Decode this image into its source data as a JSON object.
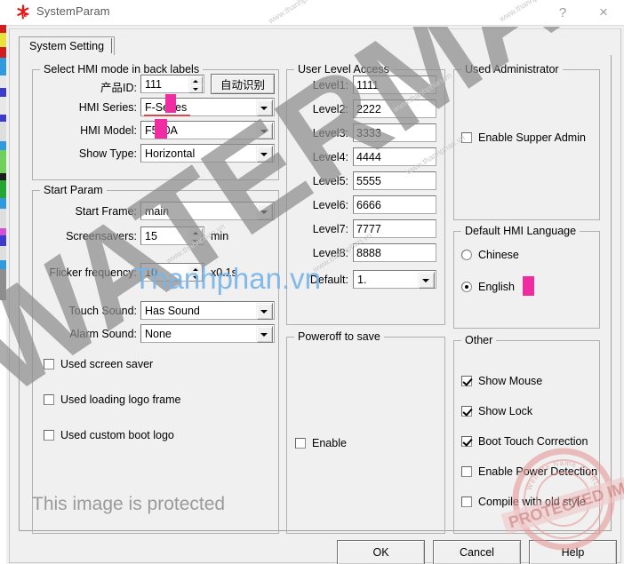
{
  "window": {
    "title": "SystemParam",
    "logo_icon": "red-cross-logo-icon",
    "help_label": "?",
    "close_label": "×"
  },
  "tabs": [
    {
      "label": "System Setting",
      "selected": true
    }
  ],
  "groups": {
    "hmi_mode": {
      "title": "Select HMI mode in back labels",
      "fields": {
        "product_id": {
          "label": "产品ID:",
          "value": "111"
        },
        "auto_detect_button": {
          "label": "自动识别"
        },
        "hmi_series": {
          "label": "HMI Series:",
          "value": "F-Series"
        },
        "hmi_model": {
          "label": "HMI Model:",
          "value": "F500A"
        },
        "show_type": {
          "label": "Show Type:",
          "value": "Horizontal"
        }
      }
    },
    "start_param": {
      "title": "Start Param",
      "fields": {
        "start_frame": {
          "label": "Start Frame:",
          "value": "main"
        },
        "screensavers": {
          "label": "Screensavers:",
          "value": "15",
          "unit": "min"
        },
        "flicker_frequency": {
          "label": "Flicker frequency:",
          "value": "10",
          "unit": "x0.1s"
        },
        "touch_sound": {
          "label": "Touch Sound:",
          "value": "Has Sound"
        },
        "alarm_sound": {
          "label": "Alarm Sound:",
          "value": "None"
        }
      },
      "checkboxes": [
        {
          "label": "Used screen saver",
          "checked": false
        },
        {
          "label": "Used loading logo frame",
          "checked": false
        },
        {
          "label": "Used custom boot logo",
          "checked": false
        }
      ]
    },
    "user_level_access": {
      "title": "User Level Access",
      "levels": [
        {
          "label": "Level1:",
          "value": "1111"
        },
        {
          "label": "Level2:",
          "value": "2222"
        },
        {
          "label": "Level3:",
          "value": "3333"
        },
        {
          "label": "Level4:",
          "value": "4444"
        },
        {
          "label": "Level5:",
          "value": "5555"
        },
        {
          "label": "Level6:",
          "value": "6666"
        },
        {
          "label": "Level7:",
          "value": "7777"
        },
        {
          "label": "Level8:",
          "value": "8888"
        }
      ],
      "default": {
        "label": "Default:",
        "value": "1."
      }
    },
    "poweroff_to_save": {
      "title": "Poweroff to save",
      "checkboxes": [
        {
          "label": "Enable",
          "checked": false
        }
      ]
    },
    "used_administrator": {
      "title": "Used Administrator",
      "checkboxes": [
        {
          "label": "Enable Supper Admin",
          "checked": false
        }
      ]
    },
    "default_hmi_language": {
      "title": "Default HMI Language",
      "options": [
        {
          "label": "Chinese",
          "selected": false
        },
        {
          "label": "English",
          "selected": true
        }
      ]
    },
    "other": {
      "title": "Other",
      "checkboxes": [
        {
          "label": "Show Mouse",
          "checked": true
        },
        {
          "label": "Show Lock",
          "checked": true
        },
        {
          "label": "Boot Touch Correction",
          "checked": true
        },
        {
          "label": "Enable Power Detection",
          "checked": false
        },
        {
          "label": "Compile with old style",
          "checked": false
        }
      ]
    }
  },
  "footer": {
    "ok": "OK",
    "cancel": "Cancel",
    "help": "Help"
  },
  "watermarks": {
    "main": "WATERMARKED",
    "site": "Thanhphan.vn",
    "protected": "This image is protected",
    "stamp_top": "PROTECTED IMAGE",
    "stamp_inner": "Website Name & URL Here"
  },
  "colors": {
    "marker_pink": "#ef2ca0",
    "dialog_bg": "#f0f0f0",
    "groupbox_border": "#b0b0b0",
    "accent_red": "#e21b1b"
  }
}
